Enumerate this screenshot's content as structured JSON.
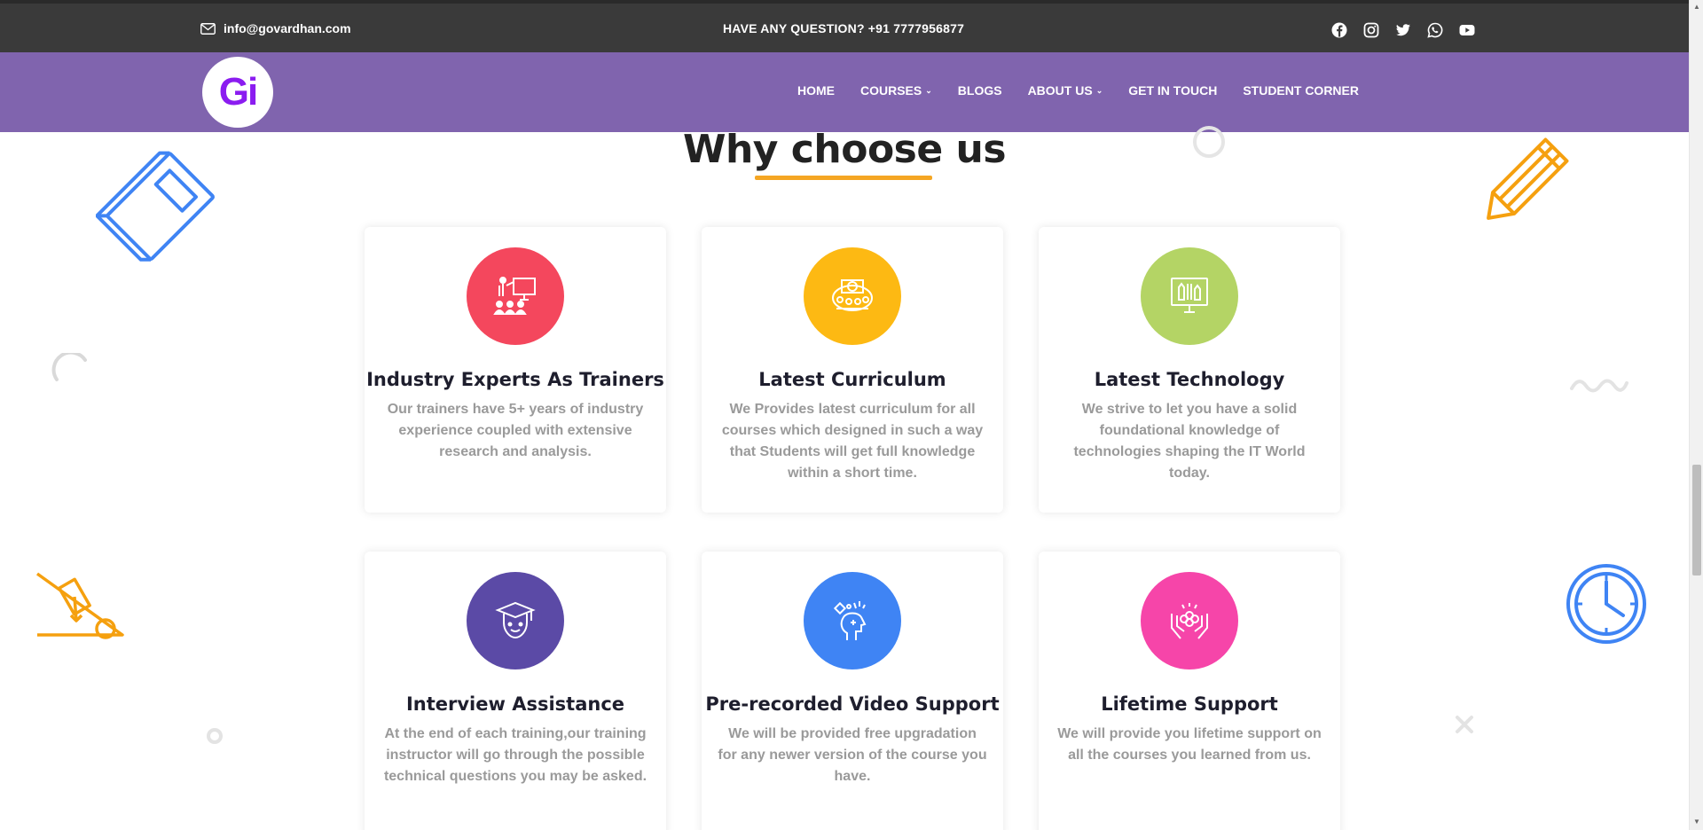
{
  "topbar": {
    "email": "info@govardhan.com",
    "question": "HAVE ANY QUESTION? +91 7777956877",
    "socials": [
      "facebook-icon",
      "instagram-icon",
      "twitter-icon",
      "whatsapp-icon",
      "youtube-icon"
    ]
  },
  "nav": {
    "logo_text": "Gi",
    "items": [
      {
        "label": "HOME",
        "dropdown": false
      },
      {
        "label": "COURSES",
        "dropdown": true
      },
      {
        "label": "BLOGS",
        "dropdown": false
      },
      {
        "label": "ABOUT US",
        "dropdown": true
      },
      {
        "label": "GET IN TOUCH",
        "dropdown": false
      },
      {
        "label": "STUDENT CORNER",
        "dropdown": false
      }
    ]
  },
  "section": {
    "heading": "Why choose us"
  },
  "cards": [
    {
      "title": "Industry Experts As Trainers",
      "desc": "Our trainers have 5+ years of industry experience coupled with extensive research and analysis.",
      "color": "#f4475d",
      "icon": "trainer-icon"
    },
    {
      "title": "Latest Curriculum",
      "desc": "We Provides latest curriculum for all courses which designed in such a way that Students will get full knowledge within a short time.",
      "color": "#fdb913",
      "icon": "curriculum-icon"
    },
    {
      "title": "Latest Technology",
      "desc": "We strive to let you have a solid foundational knowledge of technologies shaping the IT World today.",
      "color": "#b4d465",
      "icon": "technology-icon"
    },
    {
      "title": "Interview Assistance",
      "desc": "At the end of each training,our training instructor will go through the possible technical questions you may be asked.",
      "color": "#5b4aa6",
      "icon": "graduate-icon"
    },
    {
      "title": "Pre-recorded Video Support",
      "desc": "We will be provided free upgradation for any newer version of the course you have.",
      "color": "#3f84f4",
      "icon": "mind-icon"
    },
    {
      "title": "Lifetime Support",
      "desc": "We will provide you lifetime support on all the courses you learned from us.",
      "color": "#f645a9",
      "icon": "support-hands-icon"
    }
  ]
}
